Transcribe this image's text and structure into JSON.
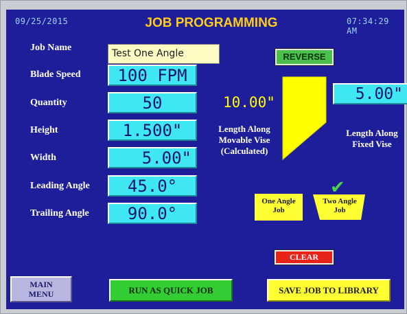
{
  "header": {
    "date": "09/25/2015",
    "title": "JOB PROGRAMMING",
    "time": "07:34:29 AM"
  },
  "fields": {
    "job_name": {
      "label": "Job Name",
      "value": "Test One Angle"
    },
    "blade_speed": {
      "label": "Blade Speed",
      "value": "100 FPM"
    },
    "quantity": {
      "label": "Quantity",
      "value": "50"
    },
    "height": {
      "label": "Height",
      "value": "1.500\""
    },
    "width": {
      "label": "Width",
      "value": "5.00\""
    },
    "leading_angle": {
      "label": "Leading Angle",
      "value": "45.0°"
    },
    "trailing_angle": {
      "label": "Trailing Angle",
      "value": "90.0°"
    }
  },
  "diagram": {
    "reverse_label": "REVERSE",
    "movable_value": "10.00\"",
    "movable_label": [
      "Length Along",
      "Movable Vise",
      "(Calculated)"
    ],
    "fixed_value": "5.00\"",
    "fixed_label": [
      "Length Along",
      "Fixed Vise"
    ],
    "checkmark": "✔",
    "one_angle_label": [
      "One Angle",
      "Job"
    ],
    "two_angle_label": [
      "Two Angle",
      "Job"
    ],
    "clear_label": "CLEAR"
  },
  "bottom": {
    "main_menu": [
      "MAIN",
      "MENU"
    ],
    "run_quick": "RUN AS QUICK JOB",
    "save_library": "SAVE JOB TO LIBRARY"
  },
  "colors": {
    "screen_bg": "#1e1e9a",
    "field_bg": "#3fe7f3",
    "title": "#ffcc1a",
    "shape": "#ffff00"
  }
}
